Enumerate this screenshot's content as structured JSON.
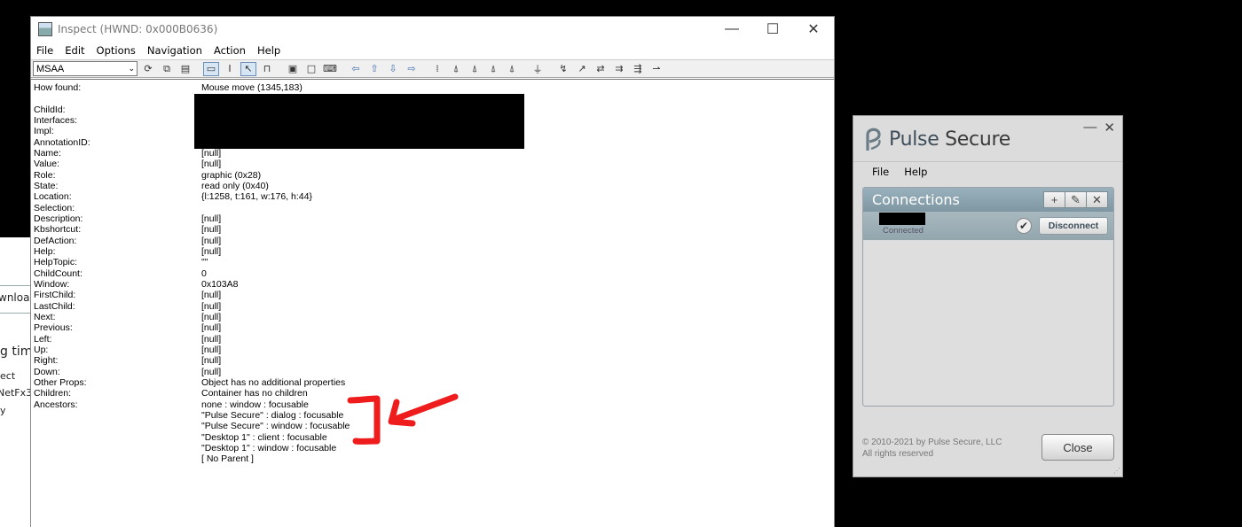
{
  "background_window": {
    "fragments": [
      "wnloa",
      "g time",
      "ect",
      "NetFx35",
      "y"
    ]
  },
  "inspect": {
    "title": "Inspect  (HWND: 0x000B0636)",
    "caption": {
      "minimize": "—",
      "maximize": "☐",
      "close": "✕"
    },
    "menu": [
      "File",
      "Edit",
      "Options",
      "Navigation",
      "Action",
      "Help"
    ],
    "mode_select": "MSAA",
    "properties": [
      {
        "label": "How found:",
        "value": "Mouse move (1345,183)"
      },
      {
        "label": "",
        "value": ""
      },
      {
        "label": "ChildId:",
        "value": ""
      },
      {
        "label": "Interfaces:",
        "value": ""
      },
      {
        "label": "Impl:",
        "value": ""
      },
      {
        "label": "AnnotationID:",
        "value": ""
      },
      {
        "label": "Name:",
        "value": "[null]"
      },
      {
        "label": "Value:",
        "value": "[null]"
      },
      {
        "label": "Role:",
        "value": "graphic (0x28)"
      },
      {
        "label": "State:",
        "value": "read only (0x40)"
      },
      {
        "label": "Location:",
        "value": "{l:1258, t:161, w:176, h:44}"
      },
      {
        "label": "Selection:",
        "value": ""
      },
      {
        "label": "Description:",
        "value": "[null]"
      },
      {
        "label": "Kbshortcut:",
        "value": "[null]"
      },
      {
        "label": "DefAction:",
        "value": "[null]"
      },
      {
        "label": "Help:",
        "value": "[null]"
      },
      {
        "label": "HelpTopic:",
        "value": "\"\""
      },
      {
        "label": "ChildCount:",
        "value": "0"
      },
      {
        "label": "Window:",
        "value": "0x103A8"
      },
      {
        "label": "FirstChild:",
        "value": "[null]"
      },
      {
        "label": "LastChild:",
        "value": "[null]"
      },
      {
        "label": "Next:",
        "value": "[null]"
      },
      {
        "label": "Previous:",
        "value": "[null]"
      },
      {
        "label": "Left:",
        "value": "[null]"
      },
      {
        "label": "Up:",
        "value": "[null]"
      },
      {
        "label": "Right:",
        "value": "[null]"
      },
      {
        "label": "Down:",
        "value": "[null]"
      },
      {
        "label": "Other Props:",
        "value": "Object has no additional properties"
      },
      {
        "label": "Children:",
        "value": "Container has no children"
      },
      {
        "label": "Ancestors:",
        "value": "none : window : focusable"
      },
      {
        "label": "",
        "value": "\"Pulse Secure\" : dialog : focusable"
      },
      {
        "label": "",
        "value": "\"Pulse Secure\" : window : focusable"
      },
      {
        "label": "",
        "value": "\"Desktop 1\" : client : focusable"
      },
      {
        "label": "",
        "value": "\"Desktop 1\" : window : focusable"
      },
      {
        "label": "",
        "value": "[ No Parent ]"
      }
    ]
  },
  "pulse": {
    "brand_pulse": "Pulse",
    "brand_secure": " Secure",
    "header_buttons": {
      "minimize": "—",
      "close": "✕"
    },
    "menu": [
      "File",
      "Help"
    ],
    "connections_title": "Connections",
    "tools": {
      "add": "+",
      "edit": "✎",
      "delete": "✕"
    },
    "connection": {
      "status": "Connected",
      "disconnect_label": "Disconnect"
    },
    "copyright_line1": "© 2010-2021 by Pulse Secure, LLC",
    "copyright_line2": "All rights reserved",
    "close_label": "Close"
  },
  "colors": {
    "annotation_red": "#ee1c1c",
    "connections_header": "#8ba3ae",
    "pulse_bg": "#dcdcdc"
  }
}
